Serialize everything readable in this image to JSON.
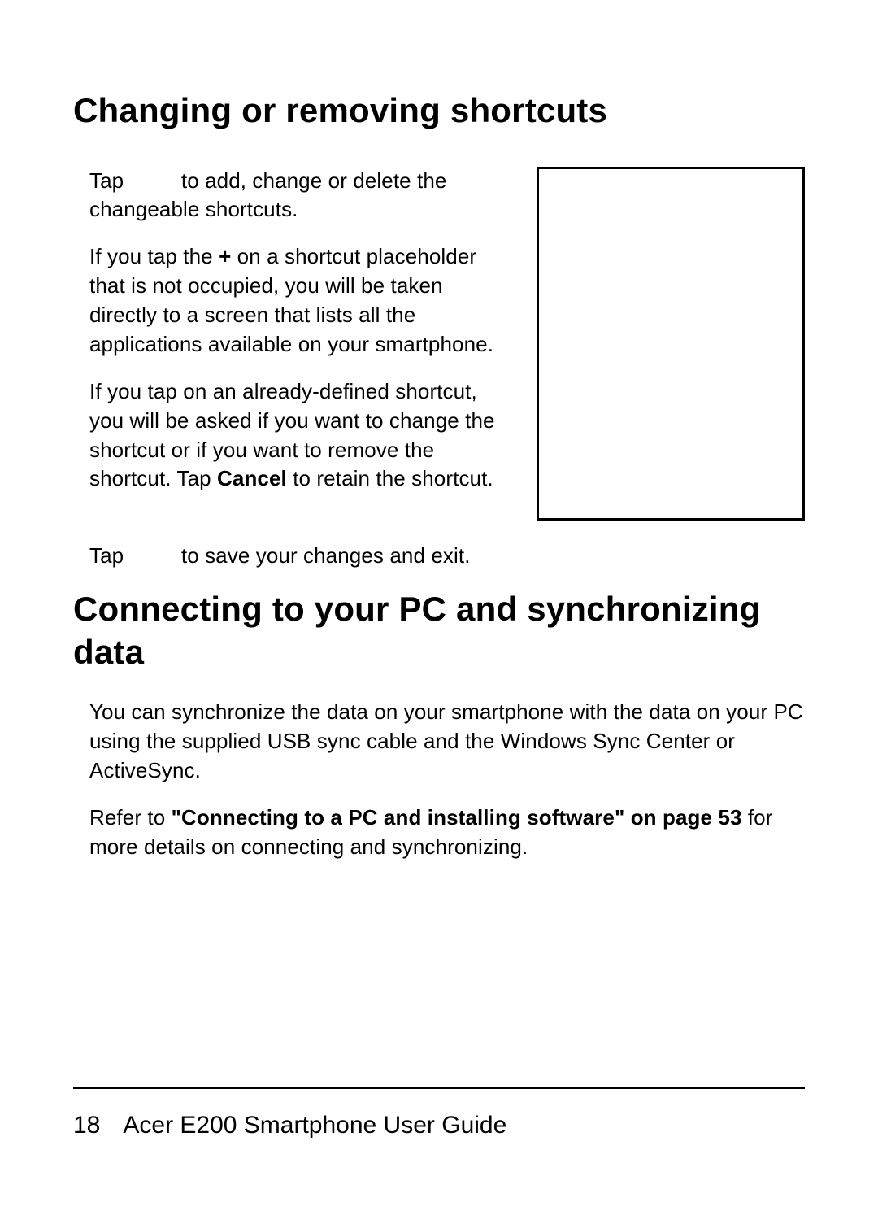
{
  "heading1": "Changing or removing shortcuts",
  "p1_a": "Tap ",
  "p1_b": " to add, change or delete the changeable shortcuts.",
  "p2_a": "If you tap the ",
  "p2_plus": "+",
  "p2_b": " on a shortcut placeholder that is not occupied, you will be taken directly to a screen that lists all the applications available on your smartphone.",
  "p3_a": "If you tap on an already-defined shortcut, you will be asked if you want to change the shortcut or if you want to remove the shortcut. Tap ",
  "p3_bold": "Cancel",
  "p3_b": " to retain the shortcut.",
  "p4_a": "Tap ",
  "p4_b": " to save your changes and exit.",
  "heading2": "Connecting to your PC and synchronizing data",
  "p5": "You can synchronize the data on your smartphone with the data on your PC using the supplied USB sync cable and the Windows Sync Center or ActiveSync.",
  "p6_a": "Refer to ",
  "p6_bold": "\"Connecting to a PC and installing software\" on page 53",
  "p6_b": " for more details on connecting and synchronizing.",
  "page_number": "18",
  "footer_title": "Acer E200 Smartphone User Guide"
}
